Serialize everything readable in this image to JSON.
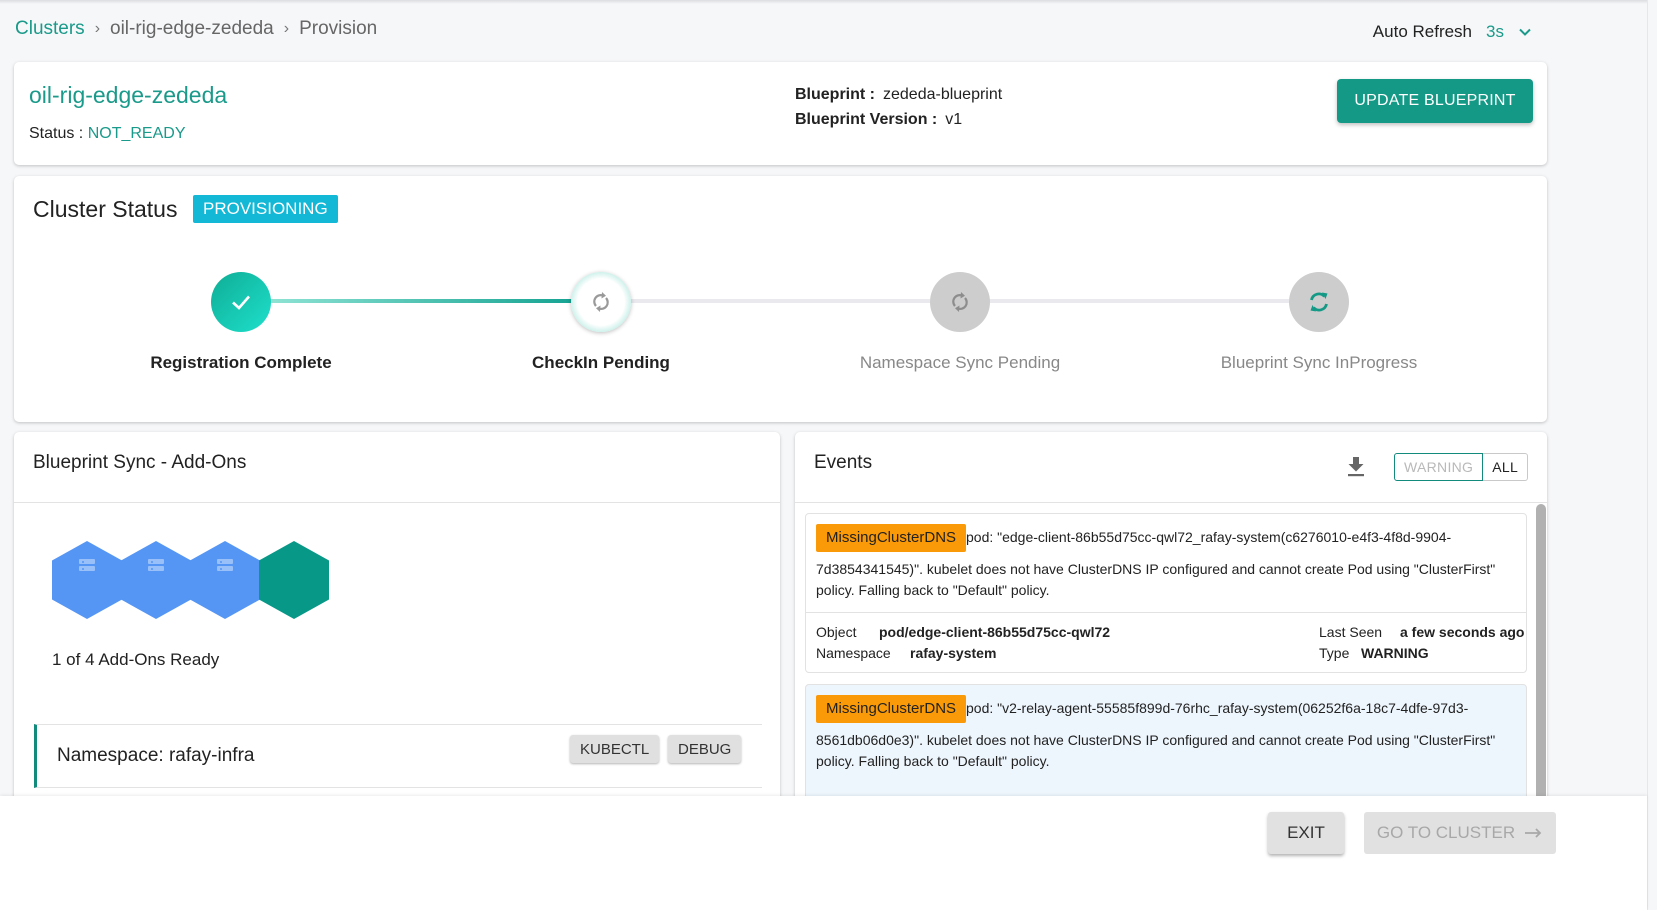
{
  "breadcrumb": [
    {
      "label": "Clusters",
      "link": true
    },
    {
      "label": "oil-rig-edge-zededa",
      "link": false
    },
    {
      "label": "Provision",
      "link": false
    }
  ],
  "breadcrumb_separator": "›",
  "auto_refresh": {
    "label": "Auto Refresh",
    "value": "3s"
  },
  "cluster": {
    "name": "oil-rig-edge-zededa",
    "status_label": "Status :",
    "status_value": "NOT_READY",
    "blueprint_label": "Blueprint :",
    "blueprint_value": "zededa-blueprint",
    "blueprint_version_label": "Blueprint Version :",
    "blueprint_version_value": "v1",
    "update_button": "UPDATE BLUEPRINT"
  },
  "cluster_status": {
    "title": "Cluster Status",
    "badge": "PROVISIONING",
    "steps": [
      {
        "label": "Registration Complete",
        "state": "complete"
      },
      {
        "label": "CheckIn Pending",
        "state": "active"
      },
      {
        "label": "Namespace Sync Pending",
        "state": "pending"
      },
      {
        "label": "Blueprint Sync InProgress",
        "state": "pending"
      }
    ]
  },
  "addons": {
    "title": "Blueprint Sync - Add-Ons",
    "ready_text": "1 of 4 Add-Ons Ready",
    "ready_count": 1,
    "total_count": 4,
    "namespace_label": "Namespace: rafay-infra",
    "kubectl_button": "KUBECTL",
    "debug_button": "DEBUG",
    "colors": {
      "pending": "#5596f5",
      "ready": "#079887"
    }
  },
  "events": {
    "title": "Events",
    "filter": {
      "warning": "WARNING",
      "all": "ALL",
      "selected": "WARNING"
    },
    "items": [
      {
        "reason": "MissingClusterDNS",
        "message_line1": "pod: \"edge-client-86b55d75cc-qwl72_rafay-system(c6276010-e4f3-4f8d-9904-",
        "message_line2": "7d3854341545)\". kubelet does not have ClusterDNS IP configured and cannot create Pod using \"ClusterFirst\" policy. Falling back to \"Default\" policy.",
        "object_label": "Object",
        "object_value": "pod/edge-client-86b55d75cc-qwl72",
        "namespace_label": "Namespace",
        "namespace_value": "rafay-system",
        "last_seen_label": "Last Seen",
        "last_seen_value": "a few seconds ago",
        "type_label": "Type",
        "type_value": "WARNING"
      },
      {
        "reason": "MissingClusterDNS",
        "message_line1": "pod: \"v2-relay-agent-55585f899d-76rhc_rafay-system(06252f6a-18c7-4dfe-97d3-",
        "message_line2": "8561db06d0e3)\". kubelet does not have ClusterDNS IP configured and cannot create Pod using \"ClusterFirst\" policy. Falling back to \"Default\" policy."
      }
    ]
  },
  "footer": {
    "exit_button": "EXIT",
    "go_button": "GO TO CLUSTER"
  }
}
